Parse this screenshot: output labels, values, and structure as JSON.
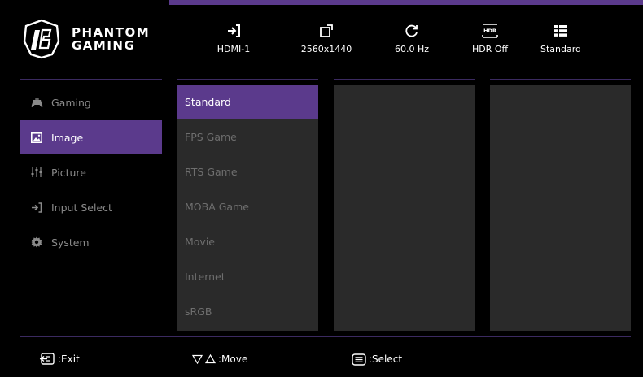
{
  "brand": {
    "line1": "PHANTOM",
    "line2": "GAMING"
  },
  "status": [
    {
      "icon": "input-arrow-icon",
      "label": "HDMI-1"
    },
    {
      "icon": "resolution-icon",
      "label": "2560x1440"
    },
    {
      "icon": "refresh-icon",
      "label": "60.0 Hz"
    },
    {
      "icon": "hdr-icon",
      "label": "HDR Off",
      "badge": "HDR"
    },
    {
      "icon": "list-icon",
      "label": "Standard"
    }
  ],
  "sidebar": {
    "items": [
      {
        "icon": "gamepad-icon",
        "label": "Gaming",
        "active": false
      },
      {
        "icon": "image-icon",
        "label": "Image",
        "active": true
      },
      {
        "icon": "sliders-icon",
        "label": "Picture",
        "active": false
      },
      {
        "icon": "input-icon",
        "label": "Input Select",
        "active": false
      },
      {
        "icon": "gear-icon",
        "label": "System",
        "active": false
      }
    ]
  },
  "modes": {
    "items": [
      "Standard",
      "FPS Game",
      "RTS Game",
      "MOBA Game",
      "Movie",
      "Internet",
      "sRGB"
    ],
    "selected": "Standard"
  },
  "footer": {
    "exit": ":Exit",
    "move": ":Move",
    "select": ":Select"
  },
  "colors": {
    "accent": "#5b3a8c",
    "panel": "#2a2a2a",
    "line": "#3b2a60",
    "inactive_text": "#8a8a8a"
  }
}
